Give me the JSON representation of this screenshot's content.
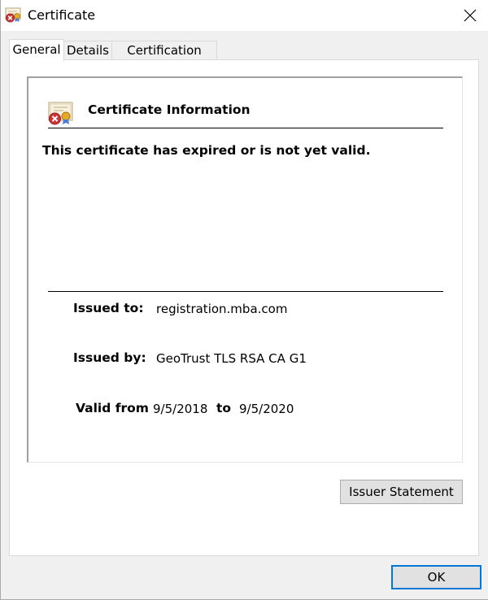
{
  "window": {
    "title": "Certificate",
    "close_icon": "close-icon",
    "title_icon": "certificate-error-icon"
  },
  "tabs": [
    {
      "label": "General",
      "active": true
    },
    {
      "label": "Details",
      "active": false
    },
    {
      "label": "Certification Path",
      "active": false
    }
  ],
  "general": {
    "section_title": "Certificate Information",
    "section_icon": "certificate-error-icon",
    "status_message": "This certificate has expired or is not yet valid.",
    "issued_to_label": "Issued to:",
    "issued_to_value": "registration.mba.com",
    "issued_by_label": "Issued by:",
    "issued_by_value": "GeoTrust TLS RSA CA G1",
    "valid_from_label": "Valid from",
    "valid_from_value": "9/5/2018",
    "valid_to_label": "to",
    "valid_to_value": "9/5/2020"
  },
  "buttons": {
    "issuer_statement": "Issuer Statement",
    "ok": "OK"
  },
  "colors": {
    "accent": "#0078d7",
    "error_red": "#d13438",
    "seal_gold": "#e5a92a"
  }
}
